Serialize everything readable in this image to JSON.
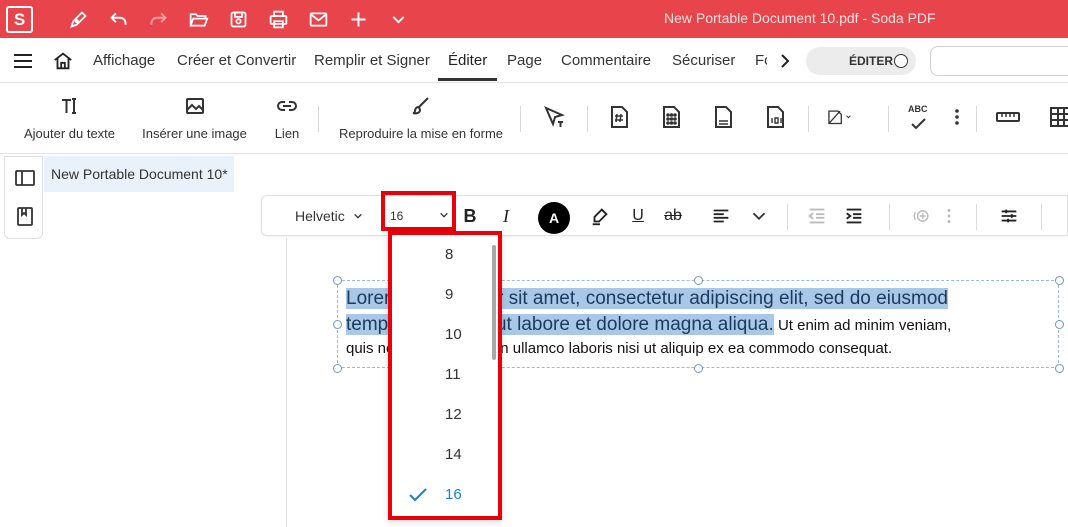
{
  "app": {
    "logo_letter": "S",
    "window_title": "New Portable Document 10.pdf  -  Soda PDF"
  },
  "menu": {
    "items": [
      "Affichage",
      "Créer et Convertir",
      "Remplir et Signer",
      "Éditer",
      "Page",
      "Commentaire",
      "Sécuriser",
      "Fo"
    ],
    "active": "Éditer",
    "edit_toggle_label": "ÉDITER"
  },
  "ribbon": {
    "add_text": "Ajouter du texte",
    "insert_image": "Insérer une image",
    "link": "Lien",
    "format_painter": "Reproduire la mise en forme",
    "spell_label": "ABC"
  },
  "document": {
    "tab_title": "New Portable Document 10*"
  },
  "format_toolbar": {
    "font_name": "Helvetic",
    "font_size": "16",
    "bold": "B",
    "italic": "I",
    "color_letter": "A",
    "underline": "U",
    "strike": "ab"
  },
  "text_box": {
    "line1_selected": "Lorem ipsum dolor sit amet, consectetur adipiscing elit, sed do eiusmod",
    "line2_selected": "tempor incididunt ut labore et dolore magna aliqua.",
    "line2_rest": " Ut enim ad minim veniam,",
    "line3": "quis nostrud exercitation ullamco laboris nisi ut aliquip ex ea commodo consequat."
  },
  "font_size_dropdown": {
    "options": [
      "8",
      "9",
      "10",
      "11",
      "12",
      "14",
      "16"
    ],
    "selected": "16",
    "accent_color": "#1a7fd6"
  },
  "colors": {
    "brand": "#e8444b",
    "highlight_box": "#e8000b",
    "selection": "#a9c8e8"
  }
}
